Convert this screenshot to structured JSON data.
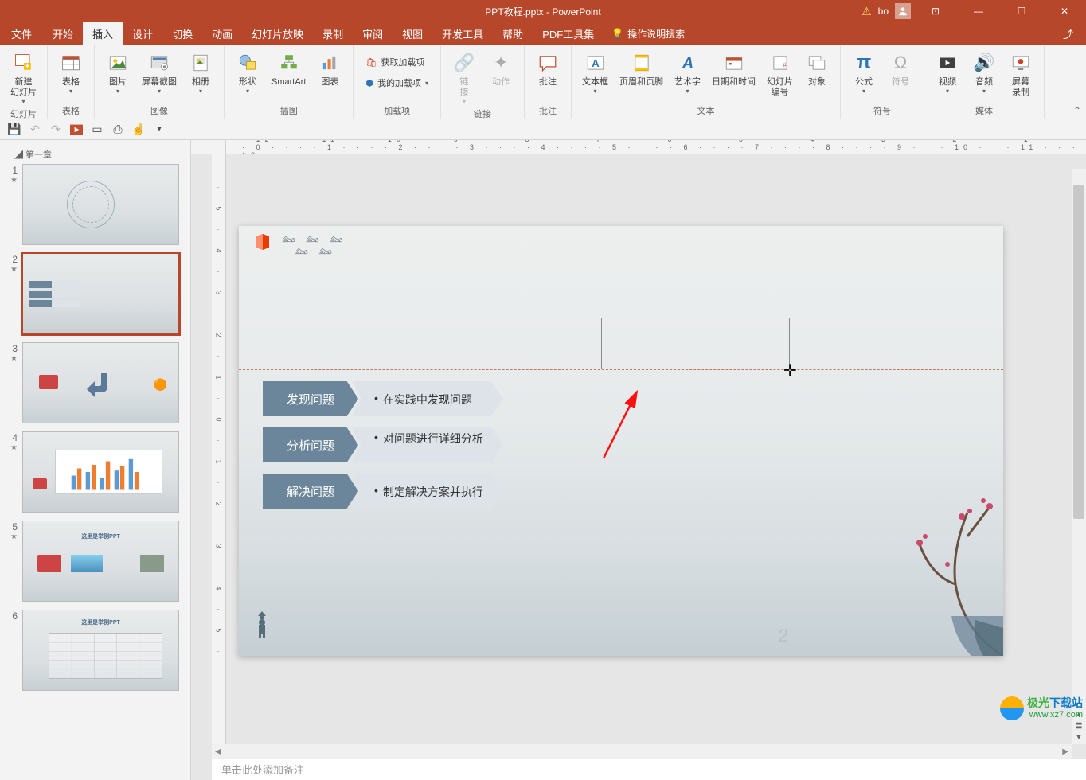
{
  "app": {
    "title": "PPT教程.pptx - PowerPoint",
    "user": "bo"
  },
  "window_controls": {
    "ribbon_options": "⊡",
    "minimize": "—",
    "maximize": "☐",
    "close": "✕"
  },
  "menu": {
    "file": "文件",
    "home": "开始",
    "insert": "插入",
    "design": "设计",
    "transition": "切换",
    "animation": "动画",
    "slideshow": "幻灯片放映",
    "record": "录制",
    "review": "审阅",
    "view": "视图",
    "developer": "开发工具",
    "help": "帮助",
    "pdf": "PDF工具集",
    "tellme": "操作说明搜索",
    "share": "⤴"
  },
  "ribbon": {
    "groups": {
      "slides": "幻灯片",
      "tables": "表格",
      "images": "图像",
      "illustrations": "插图",
      "addins": "加载项",
      "links": "链接",
      "comments": "批注",
      "text": "文本",
      "symbols": "符号",
      "media": "媒体"
    },
    "new_slide": "新建\n幻灯片",
    "table": "表格",
    "picture": "图片",
    "screenshot": "屏幕截图",
    "album": "相册",
    "shapes": "形状",
    "smartart": "SmartArt",
    "chart": "图表",
    "get_addins": "获取加载项",
    "my_addins": "我的加载项",
    "link": "链\n接",
    "action": "动作",
    "comment": "批注",
    "textbox": "文本框",
    "header_footer": "页眉和页脚",
    "wordart": "艺术字",
    "datetime": "日期和时间",
    "slide_number": "幻灯片\n编号",
    "object": "对象",
    "equation": "公式",
    "symbol": "符号",
    "video": "视频",
    "audio": "音频",
    "screen_record": "屏幕\n录制"
  },
  "outline": {
    "chapter1": "第一章"
  },
  "thumbs": {
    "slide5_title": "这里是举例PPT",
    "slide6_title": "这里是举例PPT"
  },
  "slide": {
    "row1_title": "发现问题",
    "row1_desc": "在实践中发现问题",
    "row2_title": "分析问题",
    "row2_desc": "对问题进行详细分析",
    "row3_title": "解决问题",
    "row3_desc": "制定解决方案并执行",
    "page_number": "2"
  },
  "ruler_h_text": "· 12 · · · 11 · · · 10 · · · 9 · · · · 8 · · · · 7 · · · · 6 · · · · 5 · · · · 4 · · · · 3 · · · · 2 · · · · 1 · · · · 0 · · · · 1 · · · · 2 · · · · 3 · · · · 4 · · · · 5 · · · · 6 · · · · 7 · · · · 8 · · · · 9 · · · 10 · · · 11 · · · 12 ·",
  "ruler_v_text": "· 5 · 4 · 3 · 2 · 1 · 0 · 1 · 2 · 3 · 4 · 5 ·",
  "notes": "单击此处添加备注",
  "watermark": {
    "name_a": "极光",
    "name_b": "下载站",
    "url": "www.xz7.com"
  }
}
